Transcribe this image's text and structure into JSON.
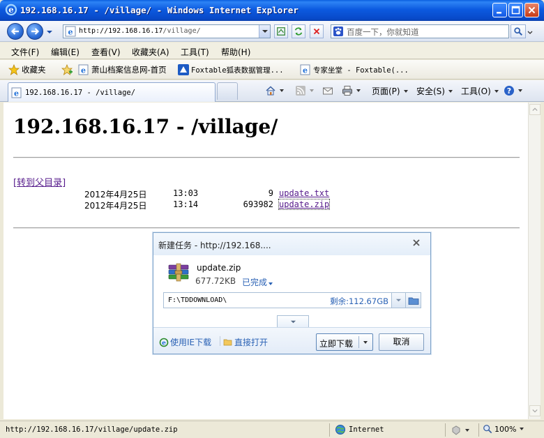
{
  "window": {
    "title": "192.168.16.17 - /village/ - Windows Internet Explorer"
  },
  "address": {
    "url_prefix": "http://192.168.16.17",
    "url_path": "/village/"
  },
  "search": {
    "placeholder": "百度一下，你就知道"
  },
  "menu": {
    "items": [
      "文件(F)",
      "编辑(E)",
      "查看(V)",
      "收藏夹(A)",
      "工具(T)",
      "帮助(H)"
    ]
  },
  "favorites": {
    "label": "收藏夹",
    "items": [
      "萧山档案信息网-首页",
      "Foxtable狐表数据管理...",
      "专家坐堂 - Foxtable(..."
    ]
  },
  "tab": {
    "label": "192.168.16.17 - /village/"
  },
  "commands": {
    "page": "页面(P)",
    "safety": "安全(S)",
    "tools": "工具(O)"
  },
  "page": {
    "heading": "192.168.16.17 - /village/",
    "parent_link": "[转到父目录]",
    "files": [
      {
        "date": "2012年4月25日",
        "time": "13:03",
        "size": "9",
        "name": "update.txt"
      },
      {
        "date": "2012年4月25日",
        "time": "13:14",
        "size": "693982",
        "name": "update.zip"
      }
    ]
  },
  "download_dialog": {
    "title": "新建任务 - http://192.168....",
    "file_name": "update.zip",
    "file_size": "677.72KB",
    "status": "已完成",
    "save_path": "F:\\TDDOWNLOAD\\",
    "free_space": "剩余:112.67GB",
    "ie_download": "使用IE下载",
    "open_direct": "直接打开",
    "download_now": "立即下载",
    "cancel": "取消"
  },
  "status": {
    "url": "http://192.168.16.17/village/update.zip",
    "zone": "Internet",
    "zoom": "100%"
  },
  "colors": {
    "link_visited": "#551A8B",
    "accent_blue": "#2A62B5",
    "titlebar": "#0C5AE0"
  }
}
